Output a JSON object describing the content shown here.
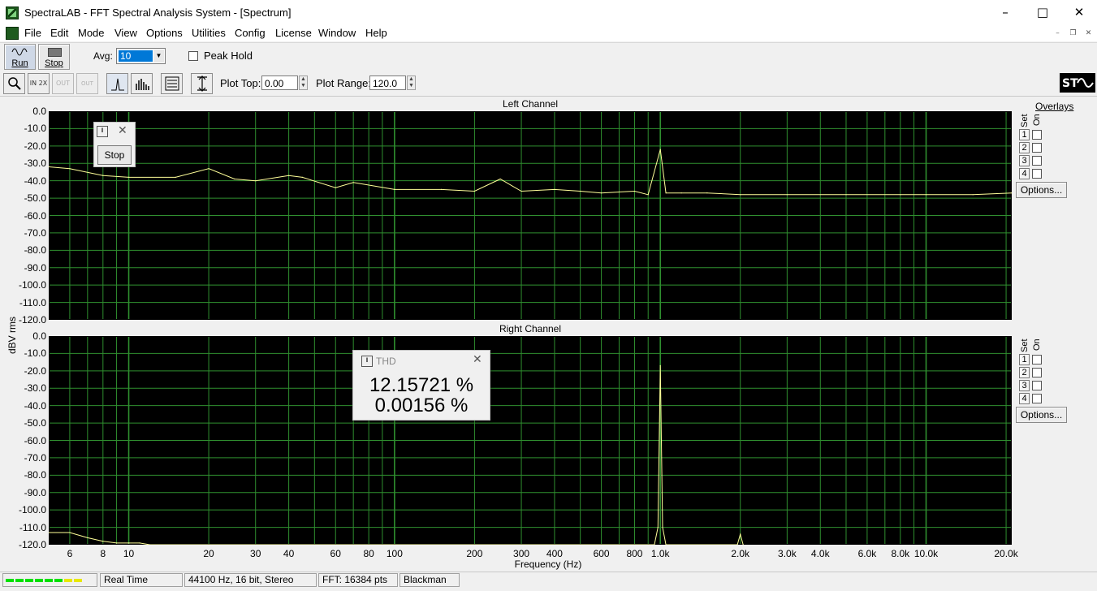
{
  "window": {
    "title": "SpectraLAB - FFT Spectral Analysis System - [Spectrum]"
  },
  "menu": [
    "File",
    "Edit",
    "Mode",
    "View",
    "Options",
    "Utilities",
    "Config",
    "License",
    "Window",
    "Help"
  ],
  "toolbar": {
    "run_label": "Run",
    "stop_label": "Stop",
    "avg_label": "Avg:",
    "avg_value": "10",
    "peak_hold_label": "Peak Hold",
    "zoom_in_label": "IN 2X",
    "zoom_out_label": "OUT 2X",
    "zoom_full_label": "OUT FULL",
    "plot_top_label": "Plot Top:",
    "plot_top_value": "0.00",
    "plot_range_label": "Plot Range:",
    "plot_range_value": "120.0"
  },
  "plots": {
    "left_title": "Left Channel",
    "right_title": "Right Channel",
    "y_axis_label": "dBV rms",
    "x_axis_label": "Frequency (Hz)",
    "y_ticks": [
      "0.0",
      "-10.0",
      "-20.0",
      "-30.0",
      "-40.0",
      "-50.0",
      "-60.0",
      "-70.0",
      "-80.0",
      "-90.0",
      "-100.0",
      "-110.0",
      "-120.0"
    ],
    "x_ticks": [
      "6",
      "8",
      "10",
      "20",
      "30",
      "40",
      "60",
      "80",
      "100",
      "200",
      "300",
      "400",
      "600",
      "800",
      "1.0k",
      "2.0k",
      "3.0k",
      "4.0k",
      "6.0k",
      "8.0k",
      "10.0k",
      "20.0k"
    ],
    "overlays_label": "Overlays",
    "set_label": "Set",
    "on_label": "On",
    "overlay_sets": [
      "1",
      "2",
      "3",
      "4"
    ],
    "options_label": "Options..."
  },
  "stop_popup": {
    "button_label": "Stop"
  },
  "thd_popup": {
    "title": "THD",
    "value_left": "12.15721 %",
    "value_right": "0.00156 %"
  },
  "status": {
    "mode": "Real Time",
    "format": "44100 Hz, 16 bit, Stereo",
    "fft": "FFT: 16384 pts",
    "window": "Blackman"
  },
  "colors": {
    "grid": "#2f8f2f",
    "trace": "#ffff99",
    "plot_bg": "#000000"
  },
  "chart_data": [
    {
      "type": "line",
      "title": "Left Channel",
      "xlabel": "Frequency (Hz)",
      "ylabel": "dBV rms",
      "xscale": "log",
      "xlim": [
        5,
        21000
      ],
      "ylim": [
        -120,
        0
      ],
      "grid": true,
      "series": [
        {
          "x": [
            5,
            6,
            8,
            10,
            15,
            20,
            25,
            30,
            40,
            45,
            60,
            70,
            100,
            150,
            200,
            250,
            300,
            400,
            500,
            600,
            800,
            900,
            1000,
            1050,
            1200,
            1500,
            2000,
            3000,
            5000,
            8000,
            10000,
            15000,
            21000
          ],
          "y": [
            -32,
            -33,
            -37,
            -38,
            -38,
            -33,
            -39,
            -40,
            -37,
            -38,
            -44,
            -41,
            -45,
            -45,
            -46,
            -39,
            -46,
            -45,
            -46,
            -47,
            -46,
            -48,
            -22,
            -47,
            -47,
            -47,
            -48,
            -48,
            -48,
            -48,
            -48,
            -48,
            -47
          ]
        }
      ]
    },
    {
      "type": "line",
      "title": "Right Channel",
      "xlabel": "Frequency (Hz)",
      "ylabel": "dBV rms",
      "xscale": "log",
      "xlim": [
        5,
        21000
      ],
      "ylim": [
        -120,
        0
      ],
      "grid": true,
      "series": [
        {
          "x": [
            5,
            6,
            7,
            8,
            9,
            10,
            11,
            12,
            950,
            980,
            1000,
            1020,
            1050,
            1950,
            2000,
            2050
          ],
          "y": [
            -113,
            -113,
            -116,
            -118,
            -119,
            -119,
            -119,
            -120,
            -120,
            -110,
            -17,
            -110,
            -120,
            -120,
            -114,
            -120
          ]
        }
      ]
    }
  ]
}
